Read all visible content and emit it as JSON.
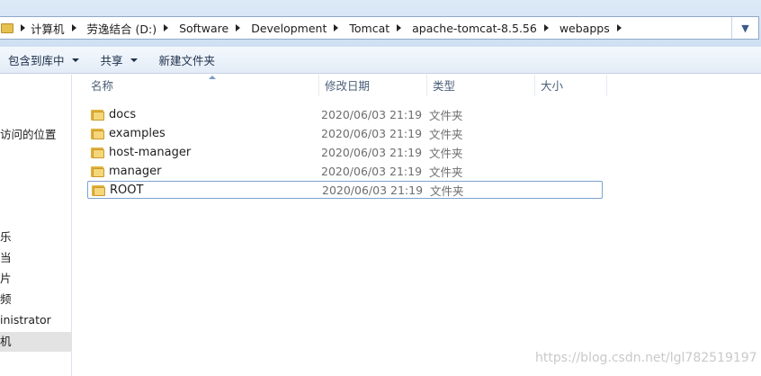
{
  "address": {
    "crumbs": [
      "计算机",
      "劳逸结合 (D:)",
      "Software",
      "Development",
      "Tomcat",
      "apache-tomcat-8.5.56",
      "webapps"
    ],
    "dropdown_glyph": "▼"
  },
  "toolbar": {
    "include_library": "包含到库中",
    "share": "共享",
    "new_folder": "新建文件夹"
  },
  "nav": {
    "items": [
      "访问的位置",
      "乐",
      "当",
      "片",
      "频",
      "inistrator",
      "机"
    ]
  },
  "list": {
    "columns": {
      "name": "名称",
      "modified": "修改日期",
      "type": "类型",
      "size": "大小"
    },
    "rows": [
      {
        "name": "docs",
        "modified": "2020/06/03 21:19",
        "type": "文件夹"
      },
      {
        "name": "examples",
        "modified": "2020/06/03 21:19",
        "type": "文件夹"
      },
      {
        "name": "host-manager",
        "modified": "2020/06/03 21:19",
        "type": "文件夹"
      },
      {
        "name": "manager",
        "modified": "2020/06/03 21:19",
        "type": "文件夹"
      },
      {
        "name": "ROOT",
        "modified": "2020/06/03 21:19",
        "type": "文件夹"
      }
    ]
  },
  "watermark": "https://blog.csdn.net/lgl782519197"
}
